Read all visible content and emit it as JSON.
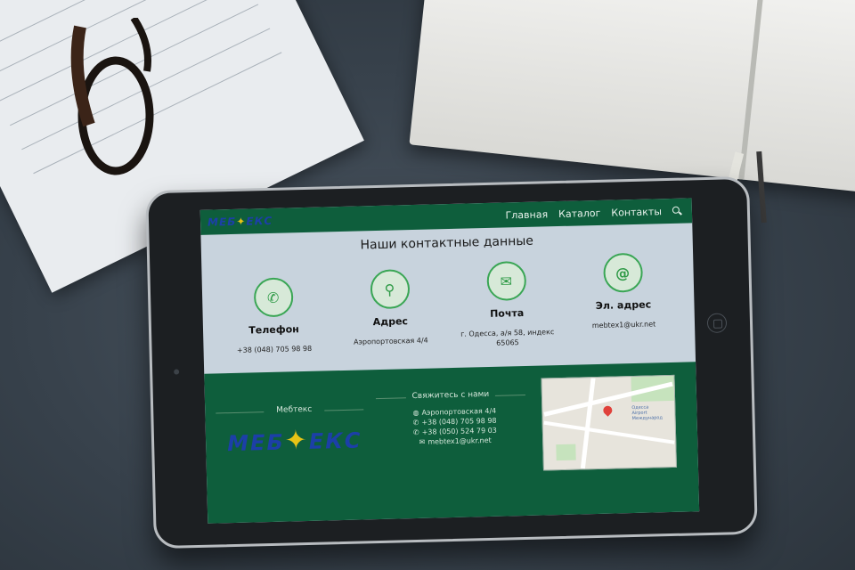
{
  "nav": {
    "logo": "МЕБ",
    "logo_end": "ЕКС",
    "links": [
      "Главная",
      "Каталог",
      "Контакты"
    ]
  },
  "page": {
    "title": "Наши контактные данные"
  },
  "contacts": [
    {
      "icon": "phone-icon",
      "name": "Телефон",
      "value": "+38 (048) 705 98 98"
    },
    {
      "icon": "map-pin-icon",
      "name": "Адрес",
      "value": "Аэропортовская 4/4"
    },
    {
      "icon": "mail-icon",
      "name": "Почта",
      "value": "г. Одесса, а/я 58, индекс 65065"
    },
    {
      "icon": "at-icon",
      "name": "Эл. адрес",
      "value": "mebtex1@ukr.net"
    }
  ],
  "footer": {
    "col1_title": "Мебтекс",
    "col2_title": "Свяжитесь с нами",
    "logo": "МЕБ",
    "logo_end": "ЕКС",
    "items": [
      {
        "icon": "globe-icon",
        "text": "Аэропортовская 4/4"
      },
      {
        "icon": "phone-icon",
        "text": "+38 (048) 705 98 98"
      },
      {
        "icon": "phone-icon",
        "text": "+38 (050) 524 79 03"
      },
      {
        "icon": "mail-icon",
        "text": "mebtex1@ukr.net"
      }
    ]
  },
  "colors": {
    "brand_green": "#0e5e3c",
    "accent_green": "#3aa655",
    "logo_blue": "#1c3fa8",
    "logo_star": "#e7c316"
  }
}
